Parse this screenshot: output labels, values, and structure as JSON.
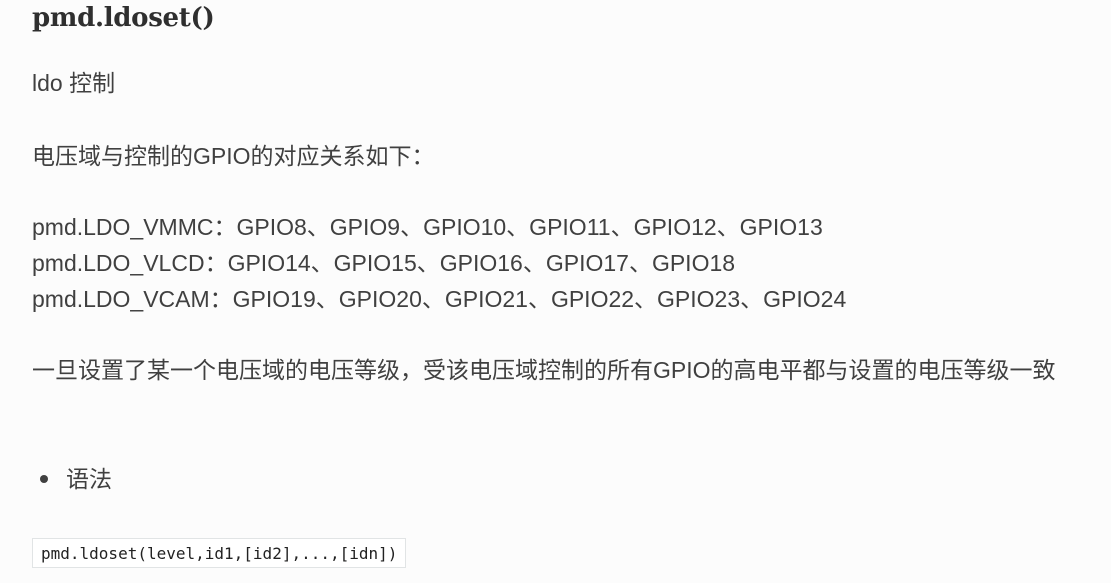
{
  "doc": {
    "title": "pmd.ldoset()",
    "intro": "ldo 控制",
    "mapping_intro": "电压域与控制的GPIO的对应关系如下：",
    "mappings": [
      "pmd.LDO_VMMC：GPIO8、GPIO9、GPIO10、GPIO11、GPIO12、GPIO13",
      "pmd.LDO_VLCD：GPIO14、GPIO15、GPIO16、GPIO17、GPIO18",
      "pmd.LDO_VCAM：GPIO19、GPIO20、GPIO21、GPIO22、GPIO23、GPIO24"
    ],
    "note": "一旦设置了某一个电压域的电压等级，受该电压域控制的所有GPIO的高电平都与设置的电压等级一致",
    "bullets": [
      "语法"
    ],
    "code": "pmd.ldoset(level,id1,[id2],...,[idn])"
  }
}
